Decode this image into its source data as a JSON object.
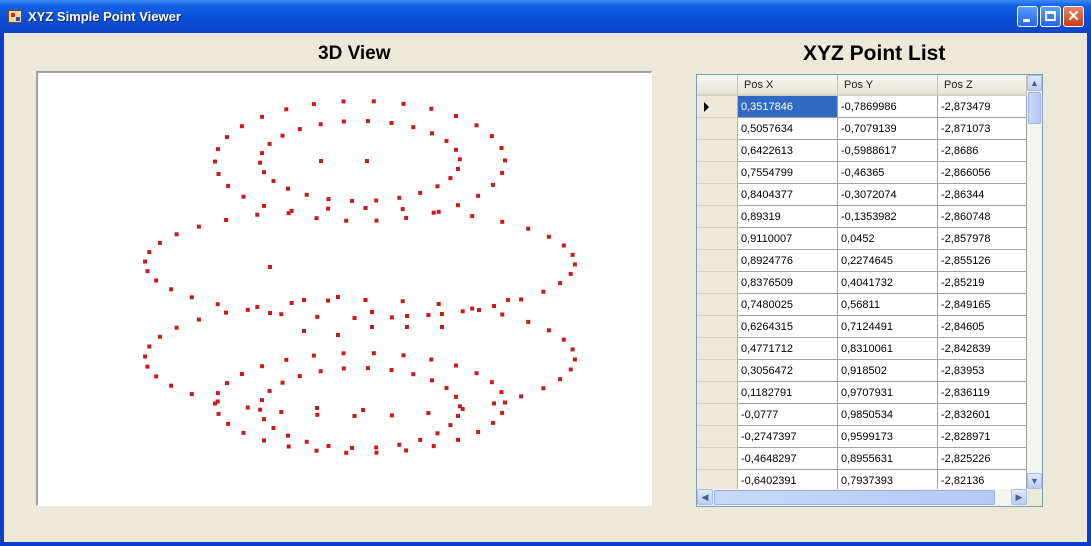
{
  "window": {
    "title": "XYZ Simple Point Viewer",
    "minimize_label": "",
    "maximize_label": "",
    "close_label": "✕",
    "titlebar_color": "#0b4fd8"
  },
  "view": {
    "title": "3D View",
    "point_color": "#cc1a1a",
    "point_count": 200
  },
  "point_list": {
    "title": "XYZ Point List",
    "columns": [
      "Pos X",
      "Pos Y",
      "Pos Z"
    ],
    "selected_row": 0,
    "rows": [
      [
        "0,3517846",
        "-0,7869986",
        "-2,873479"
      ],
      [
        "0,5057634",
        "-0,7079139",
        "-2,871073"
      ],
      [
        "0,6422613",
        "-0,5988617",
        "-2,8686"
      ],
      [
        "0,7554799",
        "-0,46365",
        "-2,866056"
      ],
      [
        "0,8404377",
        "-0,3072074",
        "-2,86344"
      ],
      [
        "0,89319",
        "-0,1353982",
        "-2,860748"
      ],
      [
        "0,9110007",
        "0,0452",
        "-2,857978"
      ],
      [
        "0,8924776",
        "0,2274645",
        "-2,855126"
      ],
      [
        "0,8376509",
        "0,4041732",
        "-2,85219"
      ],
      [
        "0,7480025",
        "0,56811",
        "-2,849165"
      ],
      [
        "0,6264315",
        "0,7124491",
        "-2,84605"
      ],
      [
        "0,4771712",
        "0,8310061",
        "-2,842839"
      ],
      [
        "0,3056472",
        "0,918502",
        "-2,83953"
      ],
      [
        "0,1182791",
        "0,9707931",
        "-2,836119"
      ],
      [
        "-0,0777",
        "0,9850534",
        "-2,832601"
      ],
      [
        "-0,2747397",
        "0,9599173",
        "-2,828971"
      ],
      [
        "-0,4648297",
        "0,8955631",
        "-2,825226"
      ],
      [
        "-0,6402391",
        "0,7937393",
        "-2,82136"
      ]
    ],
    "scroll_icons": {
      "up": "scroll-up-arrow",
      "down": "scroll-down-arrow",
      "left": "scroll-left-arrow",
      "right": "scroll-right-arrow"
    }
  }
}
